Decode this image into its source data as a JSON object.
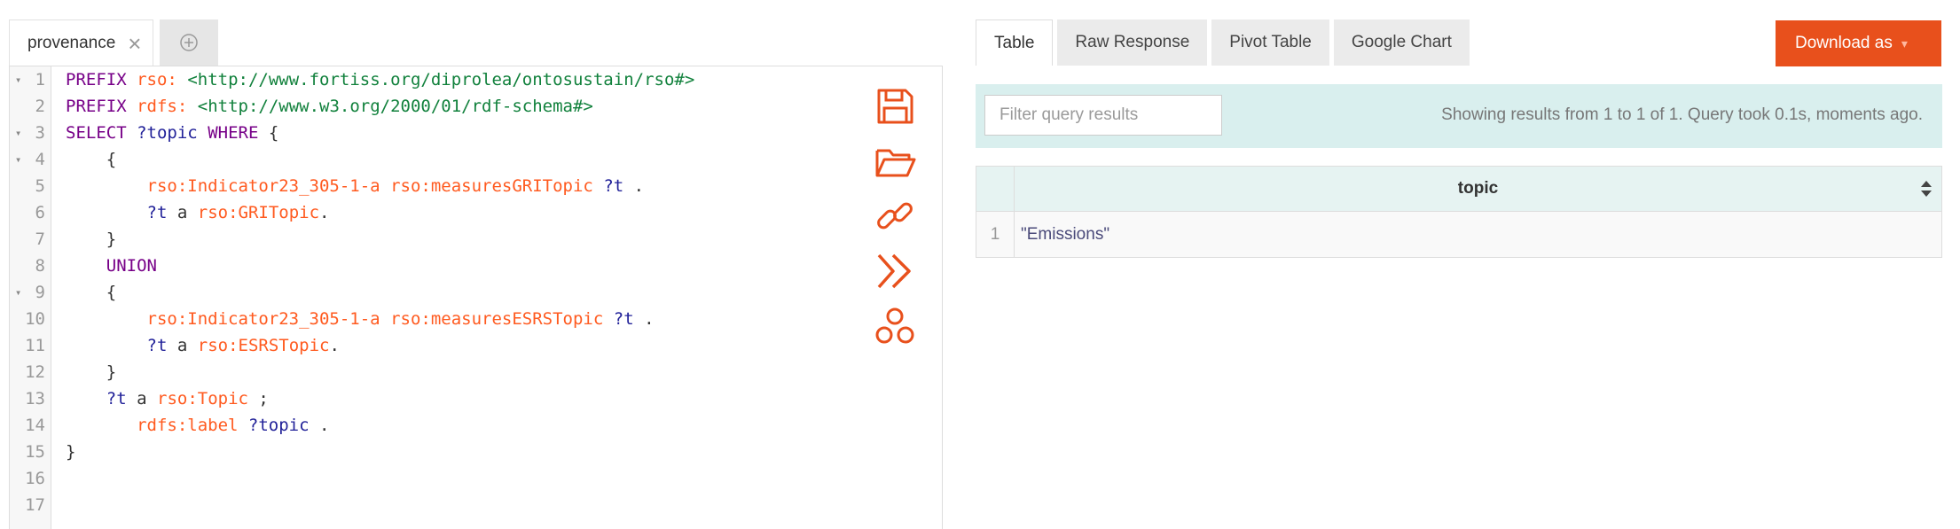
{
  "editor": {
    "tab_label": "provenance",
    "lines": [
      {
        "n": "1",
        "fold": true
      },
      {
        "n": "2",
        "fold": false
      },
      {
        "n": "3",
        "fold": true
      },
      {
        "n": "4",
        "fold": true
      },
      {
        "n": "5",
        "fold": false
      },
      {
        "n": "6",
        "fold": false
      },
      {
        "n": "7",
        "fold": false
      },
      {
        "n": "8",
        "fold": false
      },
      {
        "n": "9",
        "fold": true
      },
      {
        "n": "10",
        "fold": false
      },
      {
        "n": "11",
        "fold": false
      },
      {
        "n": "12",
        "fold": false
      },
      {
        "n": "13",
        "fold": false
      },
      {
        "n": "14",
        "fold": false
      },
      {
        "n": "15",
        "fold": false
      },
      {
        "n": "16",
        "fold": false
      },
      {
        "n": "17",
        "fold": false
      }
    ],
    "code": {
      "l1": {
        "kw": "PREFIX",
        "pfx": "rso:",
        "iri": "<http://www.fortiss.org/diprolea/ontosustain/rso#>"
      },
      "l2": {
        "kw": "PREFIX",
        "pfx": "rdfs:",
        "iri": "<http://www.w3.org/2000/01/rdf-schema#>"
      },
      "l3": {
        "kw": "SELECT",
        "var": "?topic",
        "kw2": "WHERE",
        "brace": "{"
      },
      "l4": {
        "brace": "{"
      },
      "l5": {
        "s": "rso:Indicator23_305-1-a",
        "p": "rso:measuresGRITopic",
        "o": "?t",
        "end": "."
      },
      "l6": {
        "s": "?t",
        "a": "a",
        "o": "rso:GRITopic",
        "end": "."
      },
      "l7": {
        "brace": "}"
      },
      "l8": {
        "kw": "UNION"
      },
      "l9": {
        "brace": "{"
      },
      "l10": {
        "s": "rso:Indicator23_305-1-a",
        "p": "rso:measuresESRSTopic",
        "o": "?t",
        "end": "."
      },
      "l11": {
        "s": "?t",
        "a": "a",
        "o": "rso:ESRSTopic",
        "end": "."
      },
      "l12": {
        "brace": "}"
      },
      "l13": {
        "s": "?t",
        "a": "a",
        "o": "rso:Topic",
        "end": ";"
      },
      "l14": {
        "p": "rdfs:label",
        "o": "?topic",
        "end": "."
      },
      "l15": {
        "brace": "}"
      }
    }
  },
  "results": {
    "tabs": [
      "Table",
      "Raw Response",
      "Pivot Table",
      "Google Chart"
    ],
    "download_label": "Download as",
    "filter_placeholder": "Filter query results",
    "status": "Showing results from 1 to 1 of 1. Query took 0.1s, moments ago.",
    "column_header": "topic",
    "rows": [
      {
        "index": "1",
        "value": "\"Emissions\""
      }
    ]
  },
  "colors": {
    "accent": "#e8501c",
    "filter_bar": "#d9efee",
    "keyword": "#770088",
    "prefix": "#ff5a1f",
    "iri": "#11813c",
    "variable": "#222299"
  }
}
